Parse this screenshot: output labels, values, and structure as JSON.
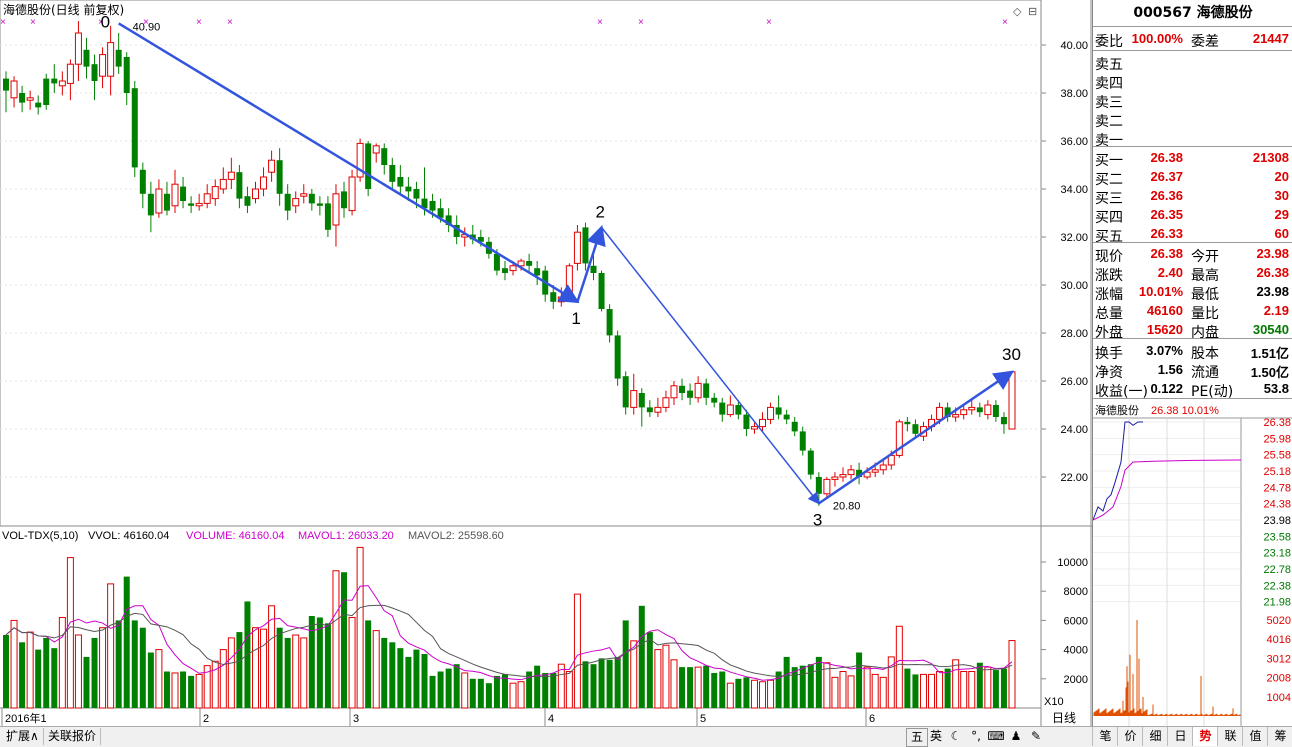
{
  "chart_data": {
    "type": "candlestick",
    "title": "海德股份(日线 前复权)",
    "ylim": [
      20,
      42
    ],
    "y_ticks": [
      22,
      24,
      26,
      28,
      30,
      32,
      34,
      36,
      38,
      40
    ],
    "x_labels": [
      "2016年1",
      "2",
      "3",
      "4",
      "5",
      "6"
    ],
    "candles": [
      [
        38.6,
        38.1,
        38.9,
        37.2
      ],
      [
        37.8,
        38.5,
        38.7,
        37.4
      ],
      [
        38.0,
        37.6,
        38.3,
        37.2
      ],
      [
        37.7,
        37.8,
        38.1,
        37.3
      ],
      [
        37.6,
        37.4,
        37.9,
        37.1
      ],
      [
        38.6,
        37.5,
        38.8,
        37.3
      ],
      [
        38.6,
        38.4,
        39.2,
        38.0
      ],
      [
        38.3,
        38.5,
        38.9,
        37.9
      ],
      [
        38.4,
        39.2,
        39.4,
        37.7
      ],
      [
        39.2,
        40.5,
        41.0,
        38.5
      ],
      [
        39.8,
        39.1,
        40.3,
        38.6
      ],
      [
        39.2,
        38.5,
        39.6,
        37.7
      ],
      [
        38.7,
        39.6,
        39.9,
        38.2
      ],
      [
        38.7,
        40.1,
        40.8,
        37.9
      ],
      [
        39.8,
        39.1,
        40.5,
        38.8
      ],
      [
        39.5,
        38.0,
        39.7,
        37.5
      ],
      [
        38.2,
        34.9,
        38.5,
        34.5
      ],
      [
        34.8,
        33.8,
        35.1,
        33.2
      ],
      [
        33.8,
        32.9,
        34.3,
        32.2
      ],
      [
        33.0,
        34.0,
        34.4,
        32.8
      ],
      [
        33.8,
        33.1,
        34.3,
        32.9
      ],
      [
        33.3,
        34.2,
        34.8,
        33.0
      ],
      [
        34.1,
        33.5,
        34.5,
        33.2
      ],
      [
        33.4,
        33.3,
        33.7,
        33.0
      ],
      [
        33.3,
        33.4,
        33.8,
        33.1
      ],
      [
        33.4,
        33.8,
        34.2,
        33.2
      ],
      [
        33.6,
        34.1,
        34.4,
        33.3
      ],
      [
        34.0,
        34.4,
        34.9,
        33.8
      ],
      [
        34.4,
        34.7,
        35.3,
        34.0
      ],
      [
        34.7,
        33.6,
        35.0,
        33.2
      ],
      [
        33.7,
        33.3,
        34.1,
        33.0
      ],
      [
        33.6,
        34.0,
        34.3,
        33.4
      ],
      [
        34.0,
        34.5,
        34.9,
        33.7
      ],
      [
        34.7,
        35.2,
        35.6,
        34.3
      ],
      [
        35.2,
        33.8,
        35.7,
        33.3
      ],
      [
        33.8,
        33.1,
        34.2,
        32.7
      ],
      [
        33.3,
        33.6,
        33.9,
        33.0
      ],
      [
        33.7,
        33.8,
        34.2,
        33.4
      ],
      [
        33.8,
        33.4,
        34.0,
        33.1
      ],
      [
        33.4,
        33.3,
        33.7,
        32.9
      ],
      [
        33.4,
        32.3,
        33.7,
        32.0
      ],
      [
        32.5,
        33.8,
        34.2,
        31.6
      ],
      [
        33.9,
        33.2,
        34.3,
        32.8
      ],
      [
        33.1,
        34.5,
        34.8,
        32.9
      ],
      [
        34.5,
        35.9,
        36.1,
        34.3
      ],
      [
        35.9,
        34.0,
        36.0,
        33.7
      ],
      [
        35.5,
        35.8,
        35.9,
        35.1
      ],
      [
        35.7,
        35.0,
        35.9,
        34.6
      ],
      [
        35.0,
        34.3,
        35.3,
        34.0
      ],
      [
        34.5,
        34.1,
        35.0,
        33.8
      ],
      [
        34.1,
        33.9,
        34.5,
        33.5
      ],
      [
        34.0,
        33.6,
        34.3,
        33.2
      ],
      [
        33.6,
        33.2,
        34.9,
        32.9
      ],
      [
        33.5,
        33.1,
        33.8,
        32.8
      ],
      [
        33.2,
        32.8,
        33.6,
        32.6
      ],
      [
        32.9,
        32.5,
        33.2,
        32.2
      ],
      [
        32.5,
        32.0,
        32.9,
        31.7
      ],
      [
        32.0,
        32.1,
        32.4,
        31.6
      ],
      [
        32.1,
        31.9,
        32.5,
        31.7
      ],
      [
        32.0,
        31.8,
        32.3,
        31.6
      ],
      [
        31.8,
        31.3,
        32.0,
        31.1
      ],
      [
        31.3,
        30.6,
        31.5,
        30.4
      ],
      [
        30.7,
        30.5,
        31.0,
        30.2
      ],
      [
        30.6,
        30.8,
        31.0,
        30.4
      ],
      [
        30.8,
        31.0,
        31.1,
        30.6
      ],
      [
        31.0,
        30.8,
        31.3,
        30.5
      ],
      [
        30.7,
        30.4,
        31.0,
        30.0
      ],
      [
        30.6,
        29.6,
        30.8,
        29.3
      ],
      [
        29.7,
        29.3,
        30.0,
        29.0
      ],
      [
        29.3,
        29.5,
        29.9,
        29.1
      ],
      [
        29.5,
        30.8,
        30.9,
        29.4
      ],
      [
        30.9,
        32.2,
        32.5,
        30.6
      ],
      [
        32.4,
        30.9,
        32.6,
        30.6
      ],
      [
        30.8,
        30.5,
        31.4,
        30.2
      ],
      [
        30.5,
        29.0,
        30.6,
        28.9
      ],
      [
        29.0,
        27.9,
        29.2,
        27.6
      ],
      [
        27.9,
        26.1,
        28.1,
        25.8
      ],
      [
        26.2,
        24.9,
        26.4,
        24.6
      ],
      [
        24.9,
        25.6,
        26.3,
        24.6
      ],
      [
        25.5,
        24.9,
        25.7,
        24.1
      ],
      [
        24.9,
        24.7,
        25.2,
        24.5
      ],
      [
        24.7,
        24.9,
        25.3,
        24.5
      ],
      [
        24.9,
        25.3,
        25.6,
        24.7
      ],
      [
        25.3,
        25.8,
        26.0,
        25.0
      ],
      [
        25.8,
        25.5,
        26.1,
        25.2
      ],
      [
        25.6,
        25.3,
        25.9,
        25.0
      ],
      [
        25.3,
        25.9,
        26.2,
        25.1
      ],
      [
        25.9,
        25.3,
        26.1,
        25.0
      ],
      [
        25.3,
        25.1,
        25.5,
        24.9
      ],
      [
        25.1,
        24.6,
        25.3,
        24.3
      ],
      [
        24.6,
        25.0,
        25.4,
        24.5
      ],
      [
        25.0,
        24.6,
        25.2,
        24.4
      ],
      [
        24.6,
        24.0,
        24.8,
        23.7
      ],
      [
        24.0,
        24.1,
        24.3,
        23.8
      ],
      [
        24.1,
        24.4,
        24.7,
        23.9
      ],
      [
        24.4,
        24.9,
        25.1,
        24.2
      ],
      [
        24.9,
        24.6,
        25.4,
        24.4
      ],
      [
        24.6,
        24.4,
        24.8,
        24.2
      ],
      [
        24.3,
        23.9,
        24.5,
        23.7
      ],
      [
        23.9,
        23.1,
        24.1,
        22.9
      ],
      [
        23.1,
        22.1,
        23.2,
        21.9
      ],
      [
        22.0,
        21.3,
        22.2,
        20.8
      ],
      [
        21.3,
        21.9,
        22.0,
        21.1
      ],
      [
        21.9,
        22.0,
        22.2,
        21.6
      ],
      [
        22.0,
        22.1,
        22.4,
        21.8
      ],
      [
        22.1,
        22.3,
        22.5,
        21.9
      ],
      [
        22.3,
        22.0,
        22.6,
        21.7
      ],
      [
        22.0,
        22.2,
        22.4,
        21.9
      ],
      [
        22.2,
        22.3,
        22.6,
        22.0
      ],
      [
        22.3,
        22.5,
        22.7,
        22.1
      ],
      [
        22.5,
        22.9,
        23.1,
        22.3
      ],
      [
        22.9,
        24.3,
        24.4,
        22.8
      ],
      [
        24.3,
        24.2,
        24.5,
        23.9
      ],
      [
        24.2,
        23.8,
        24.4,
        23.6
      ],
      [
        23.7,
        24.1,
        24.3,
        23.5
      ],
      [
        24.1,
        24.4,
        24.6,
        23.9
      ],
      [
        24.4,
        24.9,
        25.1,
        24.2
      ],
      [
        24.9,
        24.5,
        25.1,
        24.3
      ],
      [
        24.5,
        24.6,
        24.9,
        24.3
      ],
      [
        24.6,
        24.8,
        25.0,
        24.4
      ],
      [
        24.8,
        24.9,
        25.2,
        24.6
      ],
      [
        24.9,
        24.7,
        25.1,
        24.5
      ],
      [
        24.6,
        25.0,
        25.2,
        24.4
      ],
      [
        25.0,
        24.5,
        25.2,
        24.3
      ],
      [
        24.5,
        24.2,
        24.7,
        23.8
      ],
      [
        24.0,
        26.38,
        26.38,
        23.98
      ]
    ],
    "volume": [
      5000,
      6000,
      4500,
      5200,
      4000,
      4800,
      4100,
      6200,
      10300,
      5000,
      3500,
      4800,
      5500,
      8500,
      6000,
      9000,
      6000,
      5500,
      3800,
      4000,
      2500,
      2400,
      2500,
      2200,
      2300,
      2900,
      3200,
      4000,
      4800,
      5200,
      7300,
      5500,
      5400,
      7000,
      5500,
      4800,
      5000,
      4800,
      6300,
      6200,
      5800,
      9400,
      9300,
      6200,
      11000,
      6000,
      5300,
      4800,
      4500,
      4100,
      3500,
      4000,
      3700,
      2200,
      2500,
      2700,
      3000,
      2400,
      2000,
      2000,
      1700,
      2200,
      2300,
      1700,
      1800,
      2500,
      2900,
      2400,
      2400,
      3000,
      2500,
      7800,
      3200,
      3000,
      3400,
      3300,
      3500,
      6000,
      4600,
      7000,
      5200,
      4000,
      4300,
      3300,
      2800,
      2800,
      2800,
      2900,
      2400,
      2500,
      1700,
      2000,
      2100,
      1900,
      1800,
      1900,
      2500,
      3500,
      2800,
      2900,
      3000,
      3500,
      3100,
      2100,
      2500,
      2200,
      3800,
      2800,
      2300,
      2100,
      3500,
      5600,
      2700,
      2300,
      2300,
      2300,
      2500,
      2700,
      3300,
      2500,
      2500,
      3100,
      2800,
      2600,
      2700,
      4620
    ],
    "volume_axis_ticks": [
      2000,
      4000,
      6000,
      8000,
      10000
    ],
    "annotations": [
      "0",
      "1",
      "2",
      "3",
      "30",
      "40.90",
      "20.80"
    ],
    "volume_header": {
      "name": "VOL-TDX(5,10)",
      "vvol": "VVOL: 46160.04",
      "volume": "VOLUME: 46160.04",
      "mavol1": "MAVOL1: 26033.20",
      "mavol2": "MAVOL2: 25598.60"
    },
    "volume_unit": "X10"
  },
  "colors": {
    "up": "#e00000",
    "down": "#008000",
    "trend": "#3355dd",
    "ma1": "#cc00cc",
    "ma2": "#555555"
  },
  "panel": {
    "code_title": "000567 海德股份",
    "weibi_label": "委比",
    "weibi": "100.00%",
    "weicha_label": "委差",
    "weicha": "21447",
    "sell": [
      "卖五",
      "卖四",
      "卖三",
      "卖二",
      "卖一"
    ],
    "buy": [
      {
        "label": "买一",
        "price": "26.38",
        "vol": "21308"
      },
      {
        "label": "买二",
        "price": "26.37",
        "vol": "20"
      },
      {
        "label": "买三",
        "price": "26.36",
        "vol": "30"
      },
      {
        "label": "买四",
        "price": "26.35",
        "vol": "29"
      },
      {
        "label": "买五",
        "price": "26.33",
        "vol": "60"
      }
    ],
    "stats": [
      {
        "l1": "现价",
        "v1": "26.38",
        "l2": "今开",
        "v2": "23.98"
      },
      {
        "l1": "涨跌",
        "v1": "2.40",
        "l2": "最高",
        "v2": "26.38"
      },
      {
        "l1": "涨幅",
        "v1": "10.01%",
        "l2": "最低",
        "v2": "23.98"
      },
      {
        "l1": "总量",
        "v1": "46160",
        "l2": "量比",
        "v2": "2.19"
      },
      {
        "l1": "外盘",
        "v1": "15620",
        "l2": "内盘",
        "v2": "30540"
      }
    ],
    "fund": [
      {
        "l1": "换手",
        "v1": "3.07%",
        "l2": "股本",
        "v2": "1.51亿"
      },
      {
        "l1": "净资",
        "v1": "1.56",
        "l2": "流通",
        "v2": "1.50亿"
      },
      {
        "l1": "收益(一)",
        "v1": "0.122",
        "l2": "PE(动)",
        "v2": "53.8"
      }
    ],
    "mini_title": "海德股份",
    "mini_price": "26.38",
    "mini_pct": "10.01%",
    "mini_price_ticks": [
      "26.38",
      "25.98",
      "25.58",
      "25.18",
      "24.78",
      "24.38",
      "23.98",
      "23.58",
      "23.18",
      "22.78",
      "22.38",
      "21.98"
    ],
    "mini_vol_ticks": [
      "5020",
      "4016",
      "3012",
      "2008",
      "1004"
    ]
  },
  "bottom": {
    "tabs": [
      "扩展∧",
      "关联报价"
    ],
    "period_label": "日线",
    "panel_tabs": [
      "笔",
      "价",
      "细",
      "日",
      "势",
      "联",
      "值",
      "筹"
    ],
    "ime": [
      "五",
      "英"
    ]
  }
}
